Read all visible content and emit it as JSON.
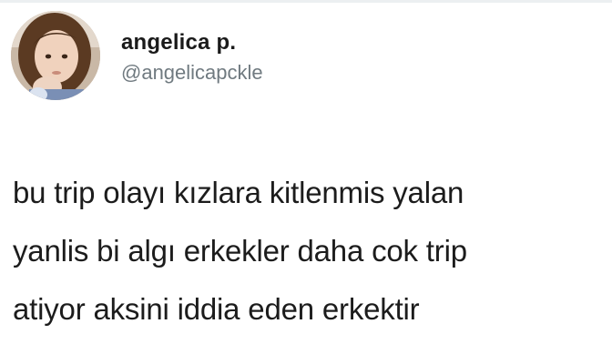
{
  "user": {
    "display_name": "angelica p.",
    "handle": "@angelicapckle",
    "avatar_icon": "profile-photo-girl"
  },
  "tweet": {
    "lines": [
      "bu trip olayı kızlara kitlenmis yalan",
      "yanlis bi algı erkekler daha cok trip",
      "atiyor aksini iddia eden erkektir"
    ]
  },
  "colors": {
    "text": "#1c1c1c",
    "handle": "#707a80",
    "background": "#ffffff"
  }
}
